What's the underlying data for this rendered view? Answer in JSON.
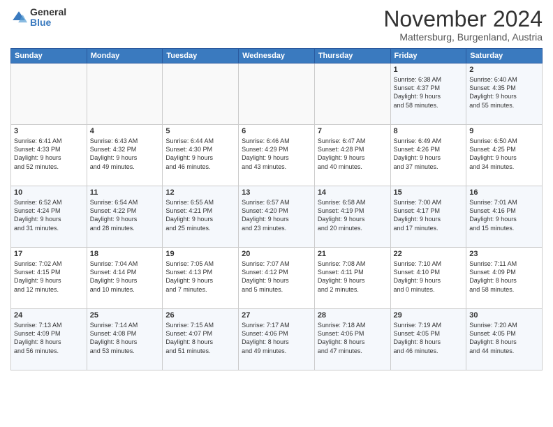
{
  "header": {
    "logo_general": "General",
    "logo_blue": "Blue",
    "month": "November 2024",
    "location": "Mattersburg, Burgenland, Austria"
  },
  "weekdays": [
    "Sunday",
    "Monday",
    "Tuesday",
    "Wednesday",
    "Thursday",
    "Friday",
    "Saturday"
  ],
  "weeks": [
    [
      {
        "day": "",
        "info": ""
      },
      {
        "day": "",
        "info": ""
      },
      {
        "day": "",
        "info": ""
      },
      {
        "day": "",
        "info": ""
      },
      {
        "day": "",
        "info": ""
      },
      {
        "day": "1",
        "info": "Sunrise: 6:38 AM\nSunset: 4:37 PM\nDaylight: 9 hours\nand 58 minutes."
      },
      {
        "day": "2",
        "info": "Sunrise: 6:40 AM\nSunset: 4:35 PM\nDaylight: 9 hours\nand 55 minutes."
      }
    ],
    [
      {
        "day": "3",
        "info": "Sunrise: 6:41 AM\nSunset: 4:33 PM\nDaylight: 9 hours\nand 52 minutes."
      },
      {
        "day": "4",
        "info": "Sunrise: 6:43 AM\nSunset: 4:32 PM\nDaylight: 9 hours\nand 49 minutes."
      },
      {
        "day": "5",
        "info": "Sunrise: 6:44 AM\nSunset: 4:30 PM\nDaylight: 9 hours\nand 46 minutes."
      },
      {
        "day": "6",
        "info": "Sunrise: 6:46 AM\nSunset: 4:29 PM\nDaylight: 9 hours\nand 43 minutes."
      },
      {
        "day": "7",
        "info": "Sunrise: 6:47 AM\nSunset: 4:28 PM\nDaylight: 9 hours\nand 40 minutes."
      },
      {
        "day": "8",
        "info": "Sunrise: 6:49 AM\nSunset: 4:26 PM\nDaylight: 9 hours\nand 37 minutes."
      },
      {
        "day": "9",
        "info": "Sunrise: 6:50 AM\nSunset: 4:25 PM\nDaylight: 9 hours\nand 34 minutes."
      }
    ],
    [
      {
        "day": "10",
        "info": "Sunrise: 6:52 AM\nSunset: 4:24 PM\nDaylight: 9 hours\nand 31 minutes."
      },
      {
        "day": "11",
        "info": "Sunrise: 6:54 AM\nSunset: 4:22 PM\nDaylight: 9 hours\nand 28 minutes."
      },
      {
        "day": "12",
        "info": "Sunrise: 6:55 AM\nSunset: 4:21 PM\nDaylight: 9 hours\nand 25 minutes."
      },
      {
        "day": "13",
        "info": "Sunrise: 6:57 AM\nSunset: 4:20 PM\nDaylight: 9 hours\nand 23 minutes."
      },
      {
        "day": "14",
        "info": "Sunrise: 6:58 AM\nSunset: 4:19 PM\nDaylight: 9 hours\nand 20 minutes."
      },
      {
        "day": "15",
        "info": "Sunrise: 7:00 AM\nSunset: 4:17 PM\nDaylight: 9 hours\nand 17 minutes."
      },
      {
        "day": "16",
        "info": "Sunrise: 7:01 AM\nSunset: 4:16 PM\nDaylight: 9 hours\nand 15 minutes."
      }
    ],
    [
      {
        "day": "17",
        "info": "Sunrise: 7:02 AM\nSunset: 4:15 PM\nDaylight: 9 hours\nand 12 minutes."
      },
      {
        "day": "18",
        "info": "Sunrise: 7:04 AM\nSunset: 4:14 PM\nDaylight: 9 hours\nand 10 minutes."
      },
      {
        "day": "19",
        "info": "Sunrise: 7:05 AM\nSunset: 4:13 PM\nDaylight: 9 hours\nand 7 minutes."
      },
      {
        "day": "20",
        "info": "Sunrise: 7:07 AM\nSunset: 4:12 PM\nDaylight: 9 hours\nand 5 minutes."
      },
      {
        "day": "21",
        "info": "Sunrise: 7:08 AM\nSunset: 4:11 PM\nDaylight: 9 hours\nand 2 minutes."
      },
      {
        "day": "22",
        "info": "Sunrise: 7:10 AM\nSunset: 4:10 PM\nDaylight: 9 hours\nand 0 minutes."
      },
      {
        "day": "23",
        "info": "Sunrise: 7:11 AM\nSunset: 4:09 PM\nDaylight: 8 hours\nand 58 minutes."
      }
    ],
    [
      {
        "day": "24",
        "info": "Sunrise: 7:13 AM\nSunset: 4:09 PM\nDaylight: 8 hours\nand 56 minutes."
      },
      {
        "day": "25",
        "info": "Sunrise: 7:14 AM\nSunset: 4:08 PM\nDaylight: 8 hours\nand 53 minutes."
      },
      {
        "day": "26",
        "info": "Sunrise: 7:15 AM\nSunset: 4:07 PM\nDaylight: 8 hours\nand 51 minutes."
      },
      {
        "day": "27",
        "info": "Sunrise: 7:17 AM\nSunset: 4:06 PM\nDaylight: 8 hours\nand 49 minutes."
      },
      {
        "day": "28",
        "info": "Sunrise: 7:18 AM\nSunset: 4:06 PM\nDaylight: 8 hours\nand 47 minutes."
      },
      {
        "day": "29",
        "info": "Sunrise: 7:19 AM\nSunset: 4:05 PM\nDaylight: 8 hours\nand 46 minutes."
      },
      {
        "day": "30",
        "info": "Sunrise: 7:20 AM\nSunset: 4:05 PM\nDaylight: 8 hours\nand 44 minutes."
      }
    ]
  ]
}
